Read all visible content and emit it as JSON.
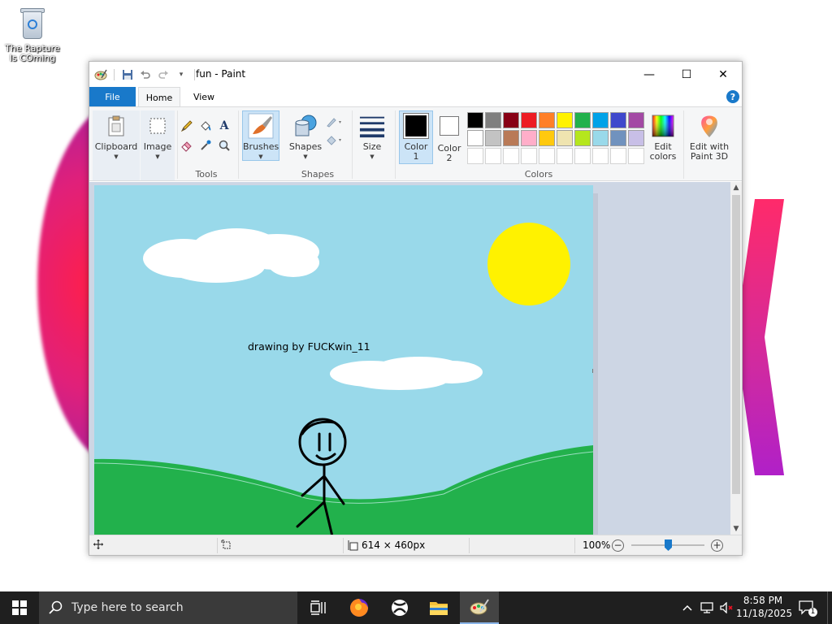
{
  "desktop": {
    "icon_label": "The Rapture Is COming"
  },
  "window": {
    "title": "fun - Paint",
    "minimize": "—",
    "maximize": "☐",
    "close": "✕"
  },
  "tabs": {
    "file": "File",
    "home": "Home",
    "view": "View",
    "help": "?"
  },
  "ribbon": {
    "clipboard": "Clipboard",
    "image": "Image",
    "tools_group": "Tools",
    "brushes": "Brushes",
    "shapes": "Shapes",
    "shapes_group": "Shapes",
    "size": "Size",
    "color1_line1": "Color",
    "color1_line2": "1",
    "color2_line1": "Color",
    "color2_line2": "2",
    "edit_colors_line1": "Edit",
    "edit_colors_line2": "colors",
    "colors_group": "Colors",
    "paint3d_line1": "Edit with",
    "paint3d_line2": "Paint 3D",
    "color1_value": "#000000",
    "color2_value": "#ffffff",
    "palette": [
      "#000000",
      "#7f7f7f",
      "#880015",
      "#ed1c24",
      "#ff7f27",
      "#fff200",
      "#22b14c",
      "#00a2e8",
      "#3f48cc",
      "#a349a4",
      "#ffffff",
      "#c3c3c3",
      "#b97a57",
      "#ffaec9",
      "#ffc90e",
      "#efe4b0",
      "#b5e61d",
      "#99d9ea",
      "#7092be",
      "#c8bfe7"
    ]
  },
  "canvas": {
    "caption": "drawing by FUCKwin_11",
    "sky": "#99d9ea",
    "grass": "#22b14c",
    "sun": "#fff200"
  },
  "status": {
    "dimensions": "614 × 460px",
    "zoom": "100%",
    "zoom_level": 0.5
  },
  "taskbar": {
    "search_placeholder": "Type here to search",
    "time": "8:58 PM",
    "date": "11/18/2025",
    "notifications": "1"
  }
}
